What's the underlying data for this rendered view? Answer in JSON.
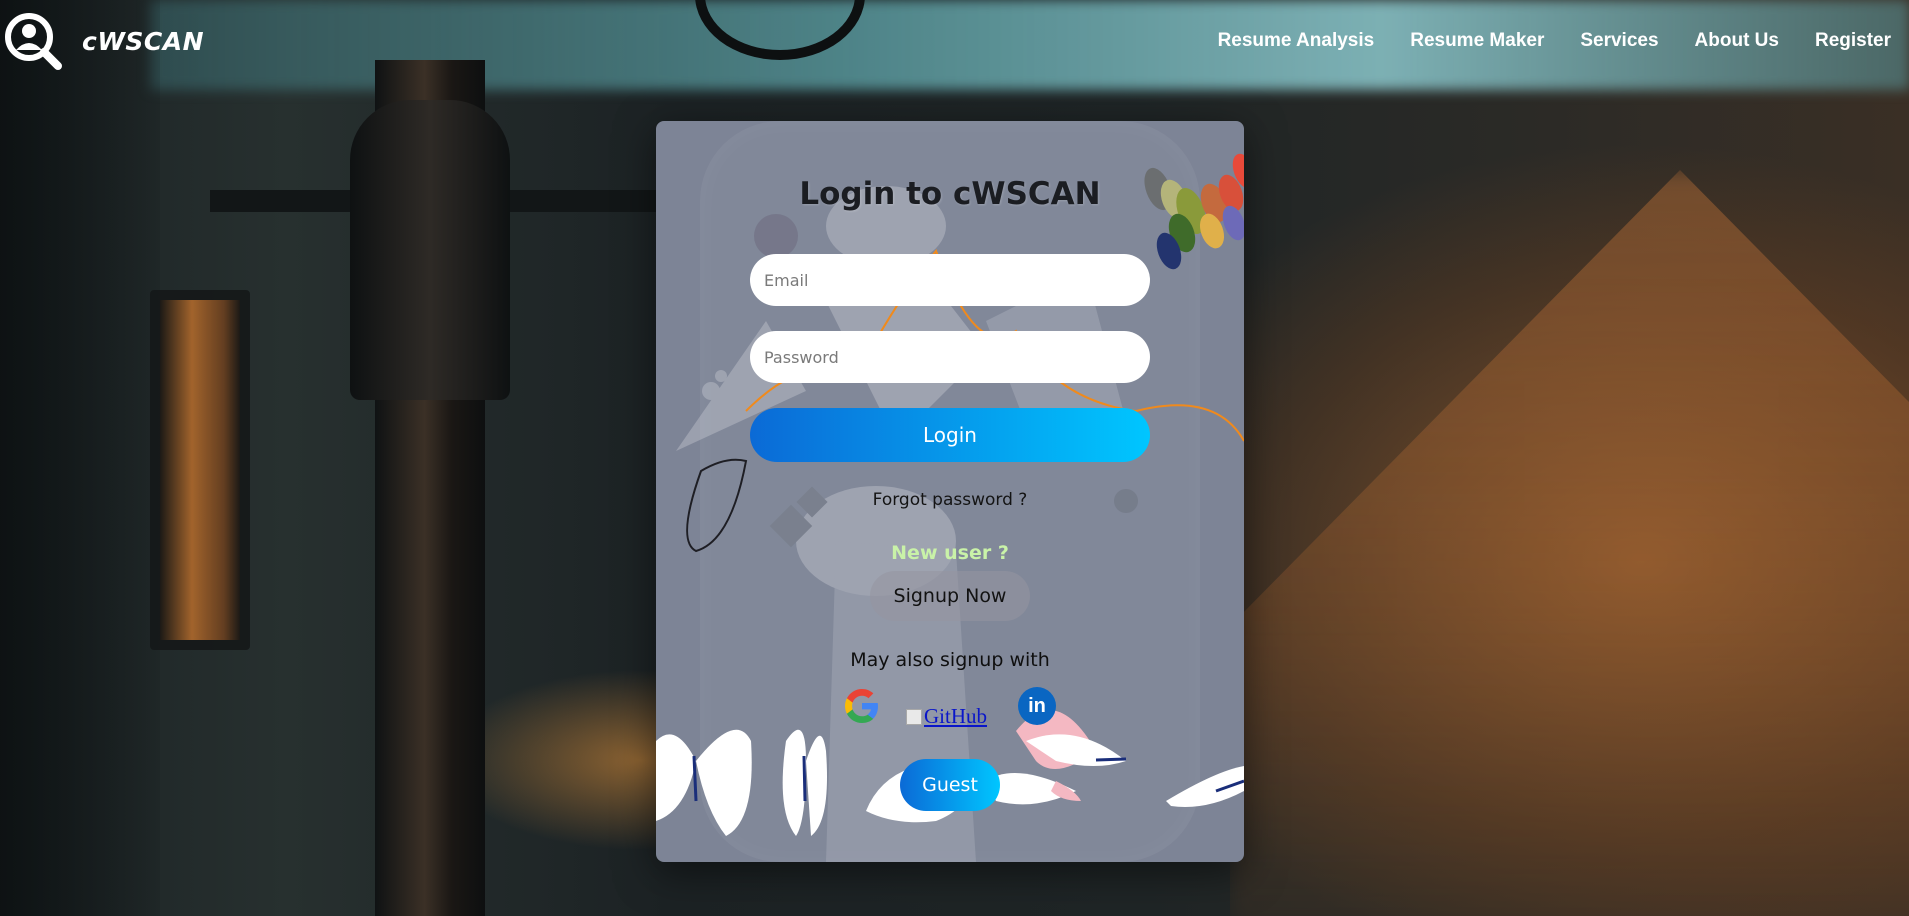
{
  "brand": {
    "name": "cWSCAN",
    "logo_icon": "magnifier-person-icon"
  },
  "nav": {
    "items": [
      {
        "label": "Resume Analysis"
      },
      {
        "label": "Resume Maker"
      },
      {
        "label": "Services"
      },
      {
        "label": "About Us"
      },
      {
        "label": "Register"
      }
    ]
  },
  "login": {
    "title": "Login to cWSCAN",
    "email_placeholder": "Email",
    "password_placeholder": "Password",
    "login_label": "Login",
    "forgot_label": "Forgot password ?",
    "new_user_label": "New user ?",
    "signup_label": "Signup Now",
    "also_signup_label": "May also signup with",
    "social": {
      "google_icon": "google-icon",
      "github_alt": "GitHub",
      "linkedin_text": "in"
    },
    "guest_label": "Guest"
  },
  "colors": {
    "card_bg": "#7d8496",
    "button_gradient_start": "#0b6ad6",
    "button_gradient_end": "#00c6ff",
    "new_user_text": "#c9f2a8",
    "link_blue": "#0a16c9",
    "linkedin": "#0a66c2"
  }
}
